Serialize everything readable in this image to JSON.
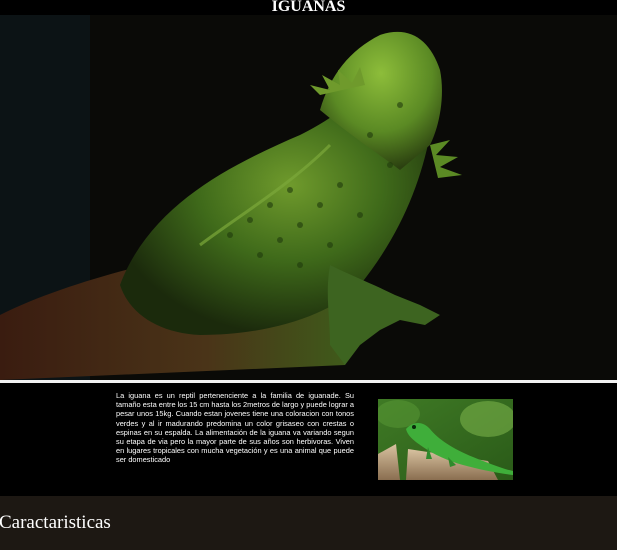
{
  "page": {
    "title": "IGUANAS"
  },
  "hero": {
    "image_icon": "bearded-dragon-photo"
  },
  "intro": {
    "text": "La iguana es un reptil pertenenciente a la familia de iguanade. Su tamaño esta entre los 15 cm hasta los 2metros de largo y puede lograr a pesar unos 15kg. Cuando estan jovenes tiene una coloracion con tonos verdes y al ir madurando predomina un color grisaseo con crestas o espinas en su espalda. La alimentación de la iguana va variando segun su etapa de via pero la mayor parte de sus años son herbivoras. Viven en lugares tropicales con mucha vegetación y es una animal que puede ser domesticado",
    "thumbnail_icon": "green-iguana-photo"
  },
  "section": {
    "heading": "Caractaristicas"
  },
  "colors": {
    "background": "#000000",
    "section_background": "#1d1813",
    "divider": "#f2f2f2",
    "text": "#ffffff"
  }
}
